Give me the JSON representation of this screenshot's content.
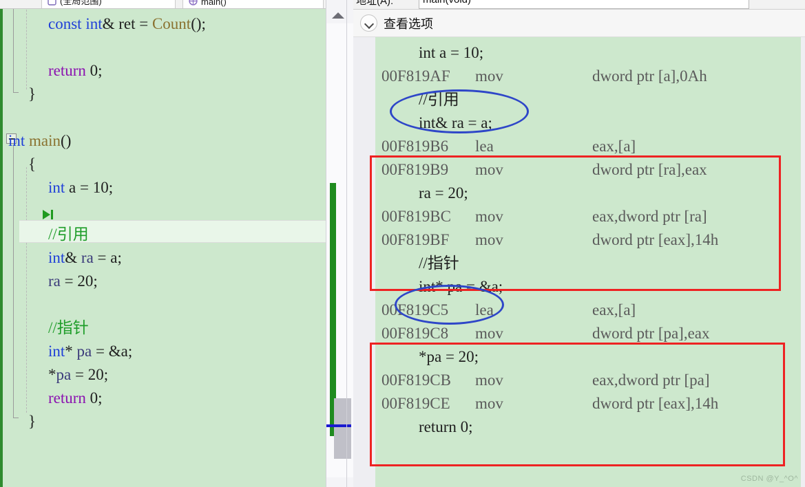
{
  "editor": {
    "tabs": [
      {
        "label": "(全局范围)",
        "icon": "scope-icon"
      },
      {
        "label": "main()",
        "icon": "method-icon"
      }
    ],
    "lines": [
      {
        "indent": 2,
        "tokens": [
          {
            "t": "const",
            "c": "kw"
          },
          {
            "t": " ",
            "c": "pun"
          },
          {
            "t": "int",
            "c": "kw"
          },
          {
            "t": "& ret = ",
            "c": "pun"
          },
          {
            "t": "Count",
            "c": "fn"
          },
          {
            "t": "();",
            "c": "pun"
          }
        ]
      },
      {
        "indent": 2,
        "tokens": []
      },
      {
        "indent": 2,
        "tokens": [
          {
            "t": "return",
            "c": "ctrl"
          },
          {
            "t": " ",
            "c": "pun"
          },
          {
            "t": "0",
            "c": "num"
          },
          {
            "t": ";",
            "c": "pun"
          }
        ]
      },
      {
        "indent": 1,
        "tokens": [
          {
            "t": "}",
            "c": "pun"
          }
        ]
      },
      {
        "indent": 1,
        "tokens": []
      },
      {
        "indent": 0,
        "tokens": [
          {
            "t": "int",
            "c": "kw"
          },
          {
            "t": " ",
            "c": "pun"
          },
          {
            "t": "main",
            "c": "fn"
          },
          {
            "t": "()",
            "c": "pun"
          }
        ]
      },
      {
        "indent": 1,
        "tokens": [
          {
            "t": "{",
            "c": "pun"
          }
        ]
      },
      {
        "indent": 2,
        "tokens": [
          {
            "t": "int",
            "c": "kw"
          },
          {
            "t": " a = ",
            "c": "pun"
          },
          {
            "t": "10",
            "c": "num"
          },
          {
            "t": ";",
            "c": "pun"
          }
        ]
      },
      {
        "indent": 2,
        "tokens": []
      },
      {
        "indent": 2,
        "selected": true,
        "tokens": [
          {
            "t": "//引用",
            "c": "cmt"
          }
        ]
      },
      {
        "indent": 2,
        "tokens": [
          {
            "t": "int",
            "c": "kw"
          },
          {
            "t": "& ",
            "c": "pun"
          },
          {
            "t": "ra",
            "c": "var"
          },
          {
            "t": " = a;",
            "c": "pun"
          }
        ]
      },
      {
        "indent": 2,
        "tokens": [
          {
            "t": "ra",
            "c": "var"
          },
          {
            "t": " = ",
            "c": "pun"
          },
          {
            "t": "20",
            "c": "num"
          },
          {
            "t": ";",
            "c": "pun"
          }
        ]
      },
      {
        "indent": 2,
        "tokens": []
      },
      {
        "indent": 2,
        "tokens": [
          {
            "t": "//指针",
            "c": "cmt"
          }
        ]
      },
      {
        "indent": 2,
        "tokens": [
          {
            "t": "int",
            "c": "kw"
          },
          {
            "t": "* ",
            "c": "pun"
          },
          {
            "t": "pa",
            "c": "var"
          },
          {
            "t": " = &a;",
            "c": "pun"
          }
        ]
      },
      {
        "indent": 2,
        "tokens": [
          {
            "t": "*",
            "c": "pun"
          },
          {
            "t": "pa",
            "c": "var"
          },
          {
            "t": " = ",
            "c": "pun"
          },
          {
            "t": "20",
            "c": "num"
          },
          {
            "t": ";",
            "c": "pun"
          }
        ]
      },
      {
        "indent": 2,
        "tokens": [
          {
            "t": "return",
            "c": "ctrl"
          },
          {
            "t": " ",
            "c": "pun"
          },
          {
            "t": "0",
            "c": "num"
          },
          {
            "t": ";",
            "c": "pun"
          }
        ]
      },
      {
        "indent": 1,
        "tokens": [
          {
            "t": "}",
            "c": "pun"
          }
        ]
      }
    ]
  },
  "scrollbar": {
    "up_arrow": "scroll-up-arrow",
    "change_bar_color": "#1f8b1f",
    "thumb_color": "#c0c0c8",
    "caret_marker_color": "#1a1ad0"
  },
  "disassembly": {
    "address_label": "地址(A):",
    "address_value": "main(void)",
    "address_placeholder": "main(void)",
    "view_options_label": "查看选项",
    "view_options_icon": "chevron-down-icon",
    "rows": [
      {
        "kind": "source",
        "text": "int a = 10;"
      },
      {
        "kind": "asm",
        "addr": "00F819AF",
        "mn": "mov",
        "ops": "dword ptr [a],0Ah"
      },
      {
        "kind": "source",
        "text": "//引用"
      },
      {
        "kind": "source",
        "text": "int& ra = a;"
      },
      {
        "kind": "asm",
        "addr": "00F819B6",
        "mn": "lea",
        "ops": "eax,[a]"
      },
      {
        "kind": "asm",
        "addr": "00F819B9",
        "mn": "mov",
        "ops": "dword ptr [ra],eax"
      },
      {
        "kind": "source",
        "text": "ra = 20;",
        "current": true
      },
      {
        "kind": "asm",
        "addr": "00F819BC",
        "mn": "mov",
        "ops": "eax,dword ptr [ra]"
      },
      {
        "kind": "asm",
        "addr": "00F819BF",
        "mn": "mov",
        "ops": "dword ptr [eax],14h"
      },
      {
        "kind": "source",
        "text": "//指针"
      },
      {
        "kind": "source",
        "text": "int* pa = &a;"
      },
      {
        "kind": "asm",
        "addr": "00F819C5",
        "mn": "lea",
        "ops": "eax,[a]"
      },
      {
        "kind": "asm",
        "addr": "00F819C8",
        "mn": "mov",
        "ops": "dword ptr [pa],eax"
      },
      {
        "kind": "source",
        "text": "*pa = 20;"
      },
      {
        "kind": "asm",
        "addr": "00F819CB",
        "mn": "mov",
        "ops": "eax,dword ptr [pa]"
      },
      {
        "kind": "asm",
        "addr": "00F819CE",
        "mn": "mov",
        "ops": "dword ptr [eax],14h"
      },
      {
        "kind": "source",
        "text": "return 0;"
      }
    ],
    "annotations": {
      "ellipse_1_target": "//引用",
      "ellipse_2_target": "//指针",
      "box_1_caption": "reference-assembly-block",
      "box_2_caption": "pointer-assembly-block",
      "ellipse_color": "#2e46c8",
      "box_color": "#ee2222"
    }
  },
  "watermark": {
    "text": "CSDN @Y_^O^"
  },
  "colors": {
    "editor_background": "#cde8cd",
    "keyword": "#1f3fd8",
    "control": "#8b12b0",
    "comment": "#1f9d2a",
    "function": "#8a7230",
    "address": "#5a5a5a"
  }
}
